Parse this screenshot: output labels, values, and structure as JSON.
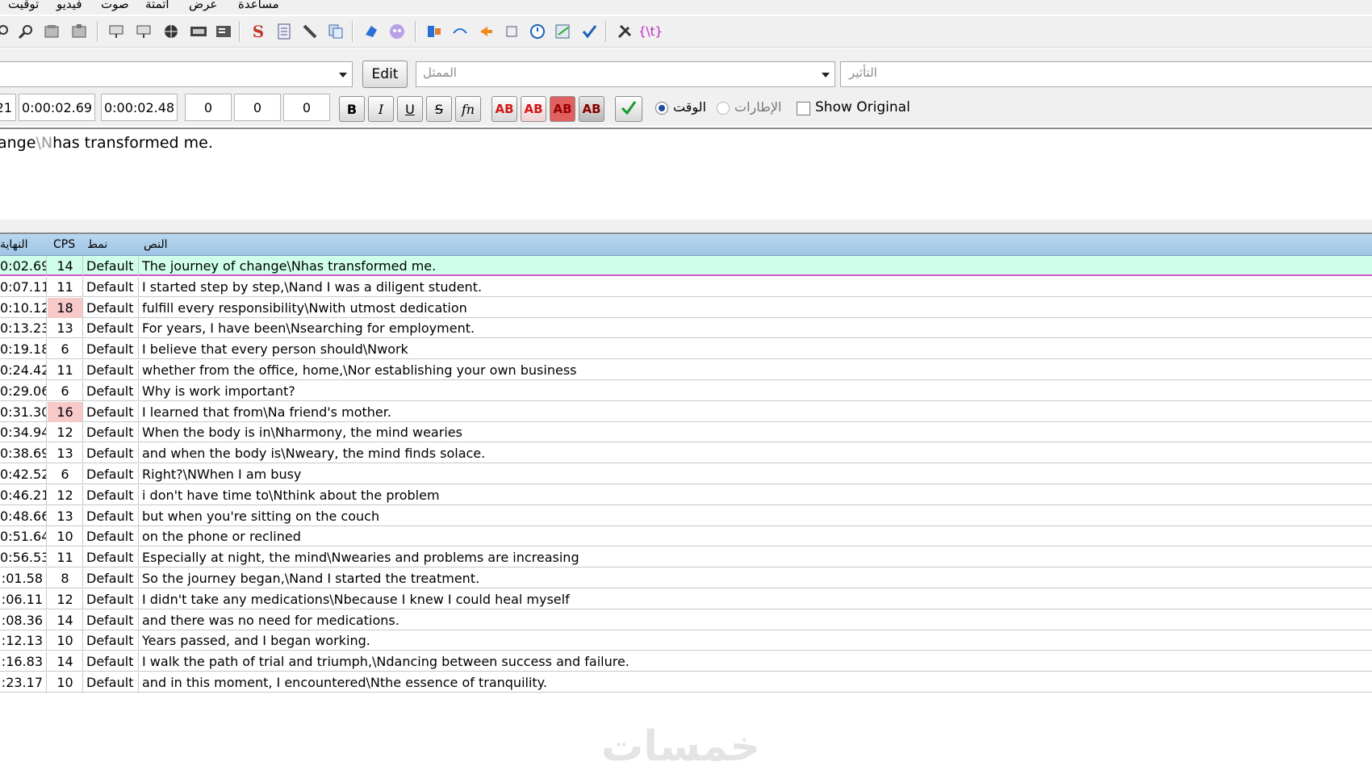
{
  "menu": {
    "items": [
      "مساعدة",
      "عرض",
      "أتمتة",
      "صوت",
      "فيديو",
      "توقيت"
    ]
  },
  "toolbar": {
    "icons": [
      "zoom-out-icon",
      "zoom-in-icon",
      "snap-start-icon",
      "snap-end-icon",
      "jump-video-start-icon",
      "jump-video-end-icon",
      "grid-icon",
      "video-icon",
      "playlist-icon",
      "styles-manager-icon",
      "attachments-icon",
      "fonts-collector-icon",
      "resample-icon",
      "translation-assistant-icon",
      "mascot-icon",
      "shift-times-icon",
      "timing-postprocessor-icon",
      "kanji-timer-icon",
      "select-lines-icon",
      "clock-icon",
      "spellcheck-icon",
      "validate-icon",
      "tools-icon",
      "override-tag-icon"
    ]
  },
  "style_bar": {
    "style_value": "",
    "edit_label": "Edit",
    "actor_placeholder": "الممثل",
    "effect_placeholder": "التأثير"
  },
  "timing_bar": {
    "layer": "21",
    "end_time": "0:00:02.69",
    "duration": "0:00:02.48",
    "margin_left": "0",
    "margin_right": "0",
    "margin_vertical": "0",
    "bold": "B",
    "italic": "I",
    "underline": "U",
    "strike": "S",
    "fn": "fn",
    "ab": "AB",
    "radio_time_label": "الوقت",
    "radio_frames_label": "الإطارات",
    "show_original_label": "Show Original"
  },
  "editor": {
    "before": "ange",
    "escape": "\\N",
    "after": "has transformed me."
  },
  "grid": {
    "headers": {
      "end": "النهاية",
      "cps": "CPS",
      "style": "نمط",
      "text": "النص"
    },
    "rows": [
      {
        "end": "0:02.69",
        "cps": "14",
        "warn": false,
        "style": "Default",
        "text": "The journey of change\\Nhas transformed me."
      },
      {
        "end": "0:07.11",
        "cps": "11",
        "warn": false,
        "style": "Default",
        "text": "I started step by step,\\Nand I was a diligent student."
      },
      {
        "end": "0:10.12",
        "cps": "18",
        "warn": true,
        "style": "Default",
        "text": "fulfill every responsibility\\Nwith utmost dedication"
      },
      {
        "end": "0:13.23",
        "cps": "13",
        "warn": false,
        "style": "Default",
        "text": "For years, I have been\\Nsearching for employment."
      },
      {
        "end": "0:19.18",
        "cps": "6",
        "warn": false,
        "style": "Default",
        "text": "I believe that every person should\\Nwork"
      },
      {
        "end": "0:24.42",
        "cps": "11",
        "warn": false,
        "style": "Default",
        "text": "whether from the office, home,\\Nor establishing your own business"
      },
      {
        "end": "0:29.06",
        "cps": "6",
        "warn": false,
        "style": "Default",
        "text": "Why is work important?"
      },
      {
        "end": "0:31.30",
        "cps": "16",
        "warn": true,
        "style": "Default",
        "text": "I learned that from\\Na friend's mother."
      },
      {
        "end": "0:34.94",
        "cps": "12",
        "warn": false,
        "style": "Default",
        "text": "When the body is in\\Nharmony, the mind wearies"
      },
      {
        "end": "0:38.69",
        "cps": "13",
        "warn": false,
        "style": "Default",
        "text": "and when the body is\\Nweary, the mind finds solace."
      },
      {
        "end": "0:42.52",
        "cps": "6",
        "warn": false,
        "style": "Default",
        "text": "Right?\\NWhen I am busy"
      },
      {
        "end": "0:46.21",
        "cps": "12",
        "warn": false,
        "style": "Default",
        "text": "i don't have time to\\Nthink about the problem"
      },
      {
        "end": "0:48.66",
        "cps": "13",
        "warn": false,
        "style": "Default",
        "text": "but when you're sitting on the couch"
      },
      {
        "end": "0:51.64",
        "cps": "10",
        "warn": false,
        "style": "Default",
        "text": "on the phone or reclined"
      },
      {
        "end": "0:56.53",
        "cps": "11",
        "warn": false,
        "style": "Default",
        "text": "Especially at night, the mind\\Nwearies and problems are increasing"
      },
      {
        "end": ":01.58",
        "cps": "8",
        "warn": false,
        "style": "Default",
        "text": "So the journey began,\\Nand I started the treatment."
      },
      {
        "end": ":06.11",
        "cps": "12",
        "warn": false,
        "style": "Default",
        "text": "I didn't take any medications\\Nbecause I knew I could heal myself"
      },
      {
        "end": ":08.36",
        "cps": "14",
        "warn": false,
        "style": "Default",
        "text": "and there was no need for medications."
      },
      {
        "end": ":12.13",
        "cps": "10",
        "warn": false,
        "style": "Default",
        "text": "Years passed, and I began working."
      },
      {
        "end": ":16.83",
        "cps": "14",
        "warn": false,
        "style": "Default",
        "text": "I walk the path of trial and triumph,\\Ndancing between success and failure."
      },
      {
        "end": ":23.17",
        "cps": "10",
        "warn": false,
        "style": "Default",
        "text": "and in this moment, I encountered\\Nthe essence of tranquility."
      }
    ]
  },
  "watermark": "خمسات",
  "colors": {
    "selected_row": "#cfffea",
    "cps_warning": "#f7c9c9",
    "header_blue": "#a9cbe8"
  }
}
